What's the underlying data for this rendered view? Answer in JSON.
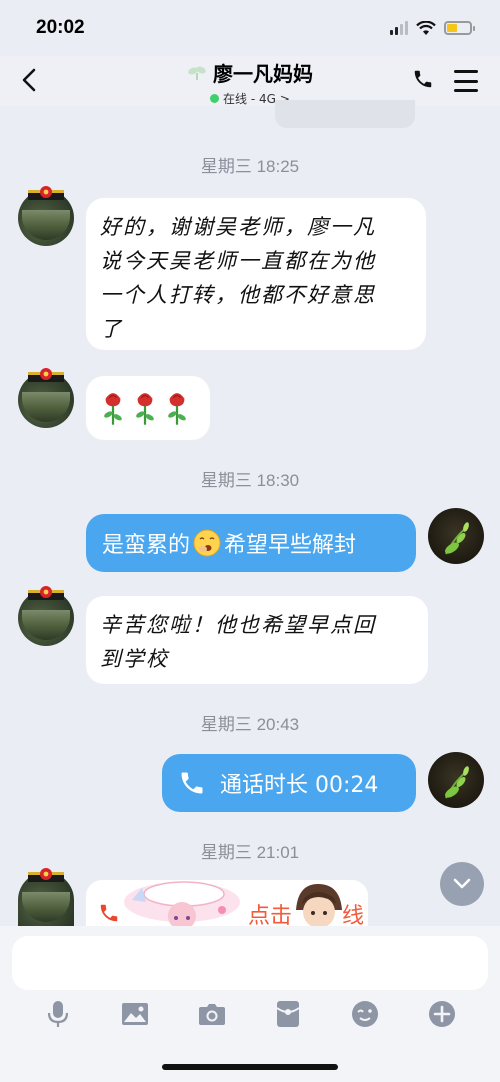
{
  "status_bar": {
    "time": "20:02"
  },
  "header": {
    "contact_name": "廖一凡妈妈",
    "presence": "在线 - 4G",
    "presence_chevron": ">"
  },
  "messages": [
    {
      "type": "timestamp",
      "text": "星期三 18:25"
    },
    {
      "type": "incoming",
      "text_lines": [
        "好的，谢谢吴老师，廖一凡",
        "说今天吴老师一直都在为他",
        "一个人打转，他都不好意思",
        "了"
      ]
    },
    {
      "type": "incoming-emoji",
      "emoji": "roses",
      "count": 3
    },
    {
      "type": "timestamp",
      "text": "星期三 18:30"
    },
    {
      "type": "outgoing",
      "text_before": "是蛮累的",
      "emoji": "yawn-face",
      "text_after": "希望早些解封"
    },
    {
      "type": "incoming",
      "text_lines": [
        "辛苦您啦！他也希望早点回",
        "到学校"
      ]
    },
    {
      "type": "timestamp",
      "text": "星期三 20:43"
    },
    {
      "type": "outgoing-call",
      "text": "通话时长 00:24",
      "icon": "phone-icon"
    },
    {
      "type": "timestamp",
      "text": "星期三 21:01"
    },
    {
      "type": "incoming-card",
      "text": "点击",
      "text_tail": "线"
    }
  ],
  "composer": {
    "placeholder": ""
  },
  "colors": {
    "outgoing_bubble": "#49a6ef",
    "incoming_bubble": "#ffffff",
    "background": "#eaedf4",
    "online": "#3dd06c"
  }
}
